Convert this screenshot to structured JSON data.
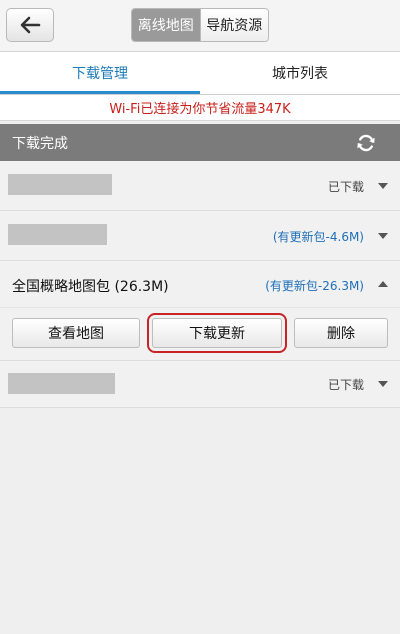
{
  "header": {
    "back_icon": "back-arrow-icon",
    "segments": [
      {
        "label": "离线地图",
        "active": true
      },
      {
        "label": "导航资源",
        "active": false
      }
    ]
  },
  "tabs": [
    {
      "label": "下载管理",
      "active": true
    },
    {
      "label": "城市列表",
      "active": false
    }
  ],
  "notice": "Wi-Fi已连接为你节省流量347K",
  "section": {
    "title": "下载完成",
    "icon": "refresh-icon"
  },
  "rows": [
    {
      "status": "已下载"
    },
    {
      "status": "(有更新包-4.6M)"
    },
    {
      "title": "全国概略地图包 (26.3M)",
      "status": "(有更新包-26.3M)"
    },
    {
      "status": "已下载"
    }
  ],
  "actions": [
    {
      "label": "查看地图"
    },
    {
      "label": "下载更新"
    },
    {
      "label": "删除"
    }
  ],
  "colors": {
    "accent_blue": "#2a8ccc",
    "notice_red": "#c8211b",
    "highlight_red": "#c82326",
    "section_gray": "#7b7b7b"
  }
}
